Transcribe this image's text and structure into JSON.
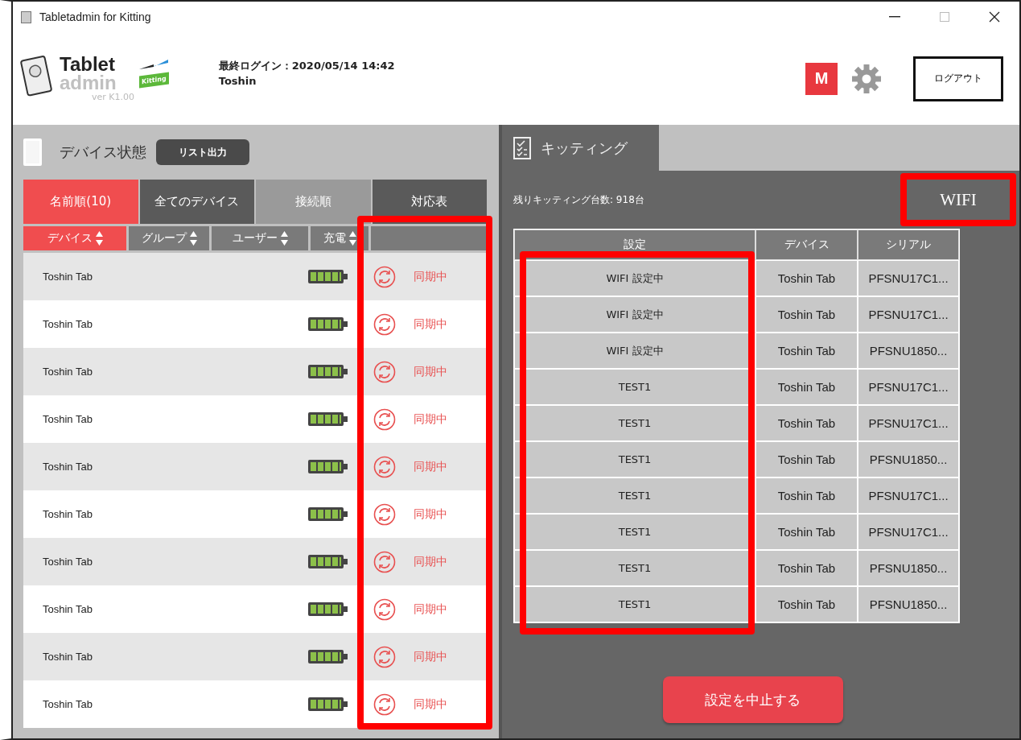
{
  "window": {
    "title": "Tabletadmin for Kitting"
  },
  "header": {
    "logo_title": "Tablet",
    "logo_subtitle": "admin",
    "logo_badge": "Kitting",
    "version": "ver K1.00",
    "last_login": "最終ログイン：2020/05/14 14:42",
    "user": "Toshin",
    "m_badge": "M",
    "logout": "ログアウト"
  },
  "device_panel": {
    "title": "デバイス状態",
    "export_button": "リスト出力",
    "tabs": [
      {
        "label": "名前順(10)",
        "selected": true
      },
      {
        "label": "全てのデバイス",
        "selected": false
      },
      {
        "label": "接続順",
        "selected": false
      },
      {
        "label": "対応表",
        "selected": false
      }
    ],
    "columns": [
      {
        "label": "デバイス",
        "selected": true
      },
      {
        "label": "グループ",
        "selected": false
      },
      {
        "label": "ユーザー",
        "selected": false
      },
      {
        "label": "充電",
        "selected": false
      }
    ],
    "rows": [
      {
        "name": "Toshin Tab",
        "level": 1,
        "status": "同期中"
      },
      {
        "name": "Toshin Tab",
        "level": 1,
        "status": "同期中"
      },
      {
        "name": "Toshin Tab",
        "level": 1,
        "status": "同期中"
      },
      {
        "name": "Toshin Tab",
        "level": 1,
        "status": "同期中"
      },
      {
        "name": "Toshin Tab",
        "level": 1,
        "status": "同期中"
      },
      {
        "name": "Toshin Tab",
        "level": 1,
        "status": "同期中"
      },
      {
        "name": "Toshin Tab",
        "level": 1,
        "status": "同期中"
      },
      {
        "name": "Toshin Tab",
        "level": 1,
        "status": "同期中"
      },
      {
        "name": "Toshin Tab",
        "level": 1,
        "status": "同期中"
      },
      {
        "name": "Toshin Tab",
        "level": 1,
        "status": "同期中"
      }
    ]
  },
  "kitting_panel": {
    "tab": "キッティング",
    "remaining": "残りキッティング台数: 918台",
    "mode": "WIFI",
    "columns": [
      "設定",
      "デバイス",
      "シリアル"
    ],
    "rows": [
      [
        "WIFI 設定中",
        "Toshin Tab",
        "PFSNU17C1..."
      ],
      [
        "WIFI 設定中",
        "Toshin Tab",
        "PFSNU17C1..."
      ],
      [
        "WIFI 設定中",
        "Toshin Tab",
        "PFSNU1850..."
      ],
      [
        "TEST1",
        "Toshin Tab",
        "PFSNU17C1..."
      ],
      [
        "TEST1",
        "Toshin Tab",
        "PFSNU17C1..."
      ],
      [
        "TEST1",
        "Toshin Tab",
        "PFSNU1850..."
      ],
      [
        "TEST1",
        "Toshin Tab",
        "PFSNU17C1..."
      ],
      [
        "TEST1",
        "Toshin Tab",
        "PFSNU17C1..."
      ],
      [
        "TEST1",
        "Toshin Tab",
        "PFSNU1850..."
      ],
      [
        "TEST1",
        "Toshin Tab",
        "PFSNU1850..."
      ]
    ],
    "stop_button": "設定を中止する"
  }
}
